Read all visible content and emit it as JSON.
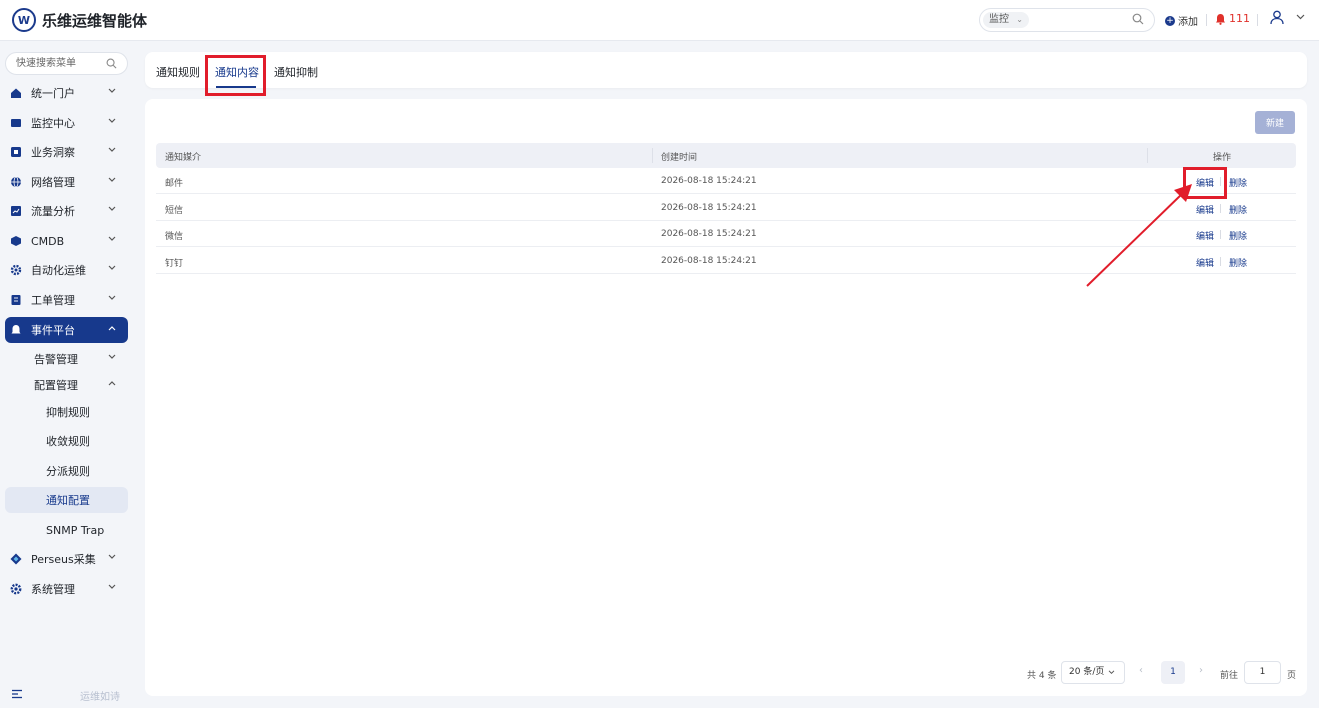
{
  "header": {
    "logo": "W",
    "title": "乐维运维智能体",
    "search_scope": "监控",
    "add_label": "添加",
    "alert_count": "111"
  },
  "sidebar": {
    "search_placeholder": "快速搜索菜单",
    "items": [
      {
        "label": "统一门户"
      },
      {
        "label": "监控中心"
      },
      {
        "label": "业务洞察"
      },
      {
        "label": "网络管理"
      },
      {
        "label": "流量分析"
      },
      {
        "label": "CMDB"
      },
      {
        "label": "自动化运维"
      },
      {
        "label": "工单管理"
      },
      {
        "label": "事件平台"
      },
      {
        "label": "Perseus采集"
      },
      {
        "label": "系统管理"
      }
    ],
    "sub_items": [
      {
        "label": "告警管理"
      },
      {
        "label": "配置管理"
      }
    ],
    "sub_sub_items": [
      {
        "label": "抑制规则"
      },
      {
        "label": "收敛规则"
      },
      {
        "label": "分派规则"
      },
      {
        "label": "通知配置"
      },
      {
        "label": "SNMP Trap"
      }
    ],
    "footer_text": "运维如诗"
  },
  "tabs": [
    {
      "label": "通知规则"
    },
    {
      "label": "通知内容"
    },
    {
      "label": "通知抑制"
    }
  ],
  "toolbar": {
    "new_label": "新建"
  },
  "table": {
    "columns": [
      "通知媒介",
      "创建时间",
      "操作"
    ],
    "rows": [
      {
        "medium": "邮件",
        "created": "2026-08-18 15:24:21"
      },
      {
        "medium": "短信",
        "created": "2026-08-18 15:24:21"
      },
      {
        "medium": "微信",
        "created": "2026-08-18 15:24:21"
      },
      {
        "medium": "钉钉",
        "created": "2026-08-18 15:24:21"
      }
    ],
    "edit_label": "编辑",
    "delete_label": "删除"
  },
  "pagination": {
    "total": "共 4 条",
    "page_size": "20 条/页",
    "current": "1",
    "goto_label": "前往",
    "goto_value": "1",
    "page_suffix": "页"
  },
  "colors": {
    "brand": "#17398c",
    "annotation": "#e11d2b",
    "alert": "#e0312b"
  }
}
